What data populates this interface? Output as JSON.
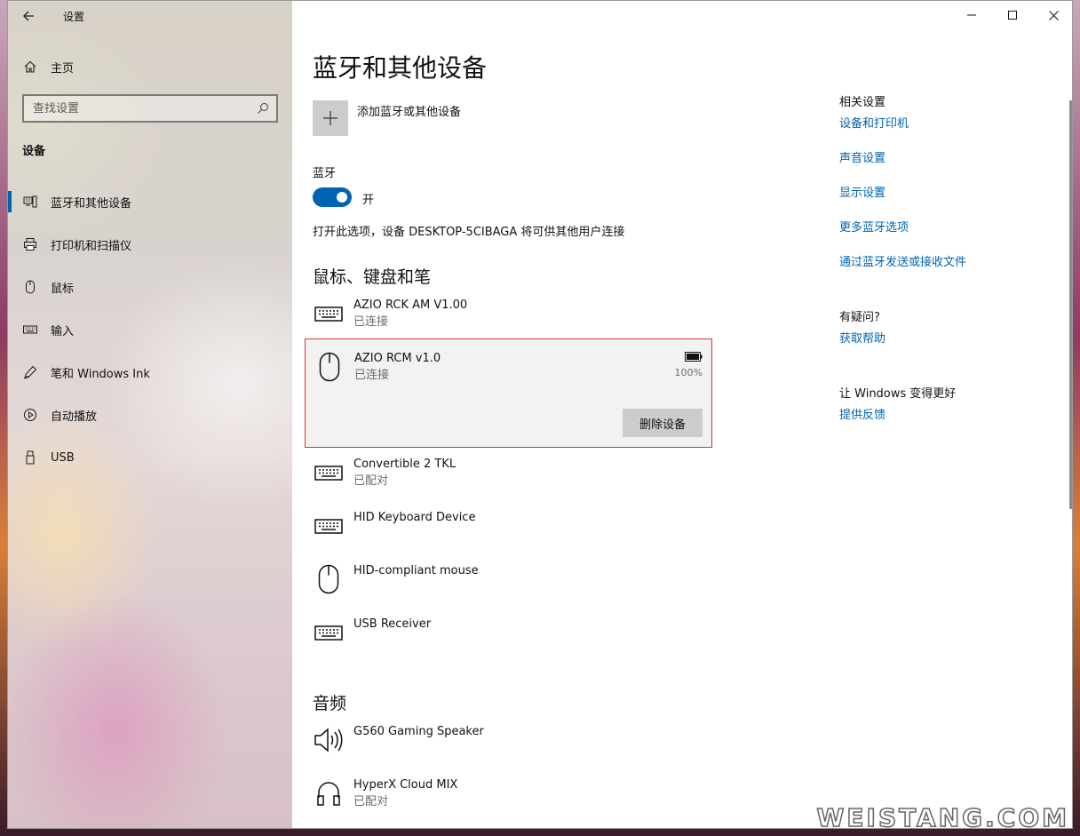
{
  "app_title": "设置",
  "sidebar": {
    "home_label": "主页",
    "search_placeholder": "查找设置",
    "section_title": "设备",
    "items": [
      {
        "label": "蓝牙和其他设备",
        "icon": "bluetooth-devices-icon"
      },
      {
        "label": "打印机和扫描仪",
        "icon": "printer-icon"
      },
      {
        "label": "鼠标",
        "icon": "mouse-icon"
      },
      {
        "label": "输入",
        "icon": "keyboard-icon"
      },
      {
        "label": "笔和 Windows Ink",
        "icon": "pen-icon"
      },
      {
        "label": "自动播放",
        "icon": "autoplay-icon"
      },
      {
        "label": "USB",
        "icon": "usb-icon"
      }
    ]
  },
  "main": {
    "title": "蓝牙和其他设备",
    "add_device_label": "添加蓝牙或其他设备",
    "bluetooth_label": "蓝牙",
    "bluetooth_state": "开",
    "discover_text": "打开此选项，设备 DESKTOP-5CIBAGA 将可供其他用户连接",
    "groups": {
      "input_heading": "鼠标、键盘和笔",
      "audio_heading": "音频"
    },
    "devices": [
      {
        "name": "AZIO RCK AM V1.00",
        "status": "已连接",
        "icon": "keyboard-icon"
      },
      {
        "name": "AZIO RCM v1.0",
        "status": "已连接",
        "icon": "mouse-icon",
        "battery": "100%",
        "action": "删除设备"
      },
      {
        "name": "Convertible 2 TKL",
        "status": "已配对",
        "icon": "keyboard-icon"
      },
      {
        "name": "HID Keyboard Device",
        "status": "",
        "icon": "keyboard-icon"
      },
      {
        "name": "HID-compliant mouse",
        "status": "",
        "icon": "mouse-icon"
      },
      {
        "name": "USB Receiver",
        "status": "",
        "icon": "keyboard-icon"
      },
      {
        "name": "G560 Gaming Speaker",
        "status": "",
        "icon": "speaker-icon"
      },
      {
        "name": "HyperX Cloud MIX",
        "status": "已配对",
        "icon": "headphones-icon"
      }
    ]
  },
  "related": {
    "heading": "相关设置",
    "links": [
      "设备和打印机",
      "声音设置",
      "显示设置",
      "更多蓝牙选项",
      "通过蓝牙发送或接收文件"
    ],
    "help_heading": "有疑问?",
    "help_link": "获取帮助",
    "feedback_heading": "让 Windows 变得更好",
    "feedback_link": "提供反馈"
  },
  "watermark": "WEISTANG.COM",
  "colors": {
    "accent": "#0063b1",
    "selection_border": "#e03232"
  }
}
